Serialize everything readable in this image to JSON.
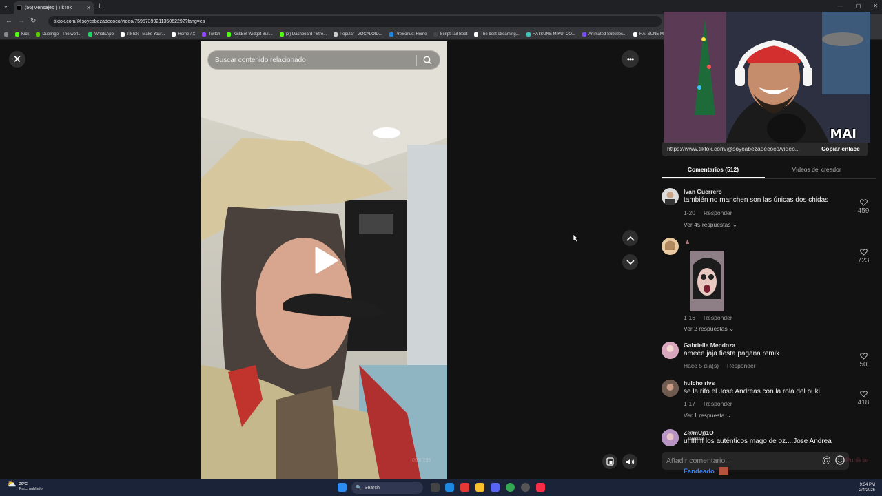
{
  "browser": {
    "tab_title": "(56)Mensajes | TikTok",
    "url": "tiktok.com/@soycabezadecoco/video/7595739921135062292?lang=es",
    "bookmarks": [
      {
        "label": "Kick",
        "color": "#53fc18"
      },
      {
        "label": "Duolingo - The worl...",
        "color": "#58cc02"
      },
      {
        "label": "WhatsApp",
        "color": "#25d366"
      },
      {
        "label": "TikTok - Make Your...",
        "color": "#ffffff"
      },
      {
        "label": "Home / X",
        "color": "#ffffff"
      },
      {
        "label": "Twitch",
        "color": "#9146ff"
      },
      {
        "label": "KickBot Widget Buil...",
        "color": "#53fc18"
      },
      {
        "label": "(3) Dashboard / Stre...",
        "color": "#53fc18"
      },
      {
        "label": "Popular | VOCALOID...",
        "color": "#cccccc"
      },
      {
        "label": "PreSonus: Home",
        "color": "#1e88e5"
      },
      {
        "label": "Script Tail Beat",
        "color": "#444444"
      },
      {
        "label": "The best streaming...",
        "color": "#ffffff"
      },
      {
        "label": "HATSUNE MIKU: CO...",
        "color": "#39c5bb"
      },
      {
        "label": "Animated Subtitles...",
        "color": "#7c4dff"
      },
      {
        "label": "HATSUNE MI",
        "color": "#ffffff"
      }
    ]
  },
  "video": {
    "search_placeholder": "Buscar contenido relacionado",
    "timecode": "00/00:38"
  },
  "panel": {
    "share_url": "https://www.tiktok.com/@soycabezadecoco/video...",
    "copy_label": "Copiar enlace",
    "tab_comments": "Comentarios (512)",
    "tab_creator": "Vídeos del creador",
    "comments": [
      {
        "name": "Ivan Guerrero",
        "text": "también no manchen son las únicas dos chidas",
        "date": "1-20",
        "reply": "Responder",
        "replies": "Ver 45 respuestas",
        "likes": "459"
      },
      {
        "name": "",
        "text": "",
        "date": "1-16",
        "reply": "Responder",
        "replies": "Ver 2 respuestas",
        "likes": "723"
      },
      {
        "name": "Gabrielle Mendoza",
        "text": "ameee jaja fiesta pagana remix",
        "date": "Hace 5 día(s)",
        "reply": "Responder",
        "replies": "",
        "likes": "50"
      },
      {
        "name": "hulcho rivs",
        "text": "se la rifo el José Andreas con la rola del buki",
        "date": "1-17",
        "reply": "Responder",
        "replies": "Ver 1 respuesta",
        "likes": "418"
      },
      {
        "name": "Z@mUj)1O",
        "text": "ufffffffff los auténticos mago de oz....Jose Andrea",
        "date": "",
        "reply": "",
        "replies": "",
        "likes": ""
      }
    ],
    "add_comment_placeholder": "Añadir comentario...",
    "publish_label": "Publicar",
    "fandeado": "Fandeado"
  },
  "webcam": {
    "logo_text": "MAI"
  },
  "taskbar": {
    "temp": "20°C",
    "weather_desc": "Parc. nublado",
    "search_label": "Search",
    "time": "9:34 PM",
    "date": "2/4/2026"
  }
}
